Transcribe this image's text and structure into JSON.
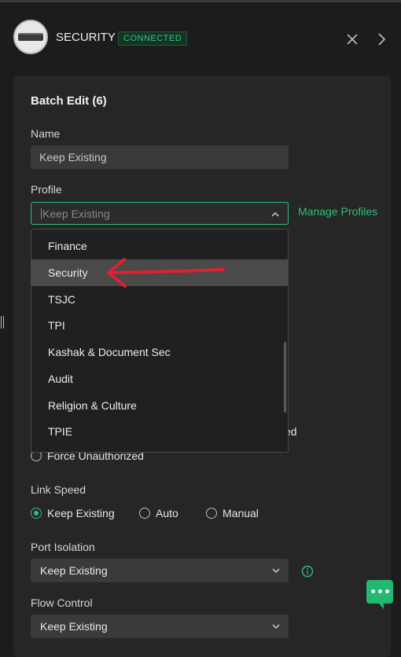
{
  "device": {
    "name": "SECURITY",
    "status": "CONNECTED"
  },
  "header": {
    "icons": [
      "close-icon",
      "chevron-right-icon"
    ]
  },
  "form": {
    "title": "Batch Edit (6)",
    "name": {
      "label": "Name",
      "placeholder": "Keep Existing"
    },
    "profile": {
      "label": "Profile",
      "placeholder": "Keep Existing",
      "manage_link": "Manage Profiles",
      "options": [
        "Finance",
        "Security",
        "TSJC",
        "TPI",
        "Kashak & Document Sec",
        "Audit",
        "Religion & Culture",
        "TPIE"
      ],
      "highlighted": "Security"
    },
    "partial_behind": "ed",
    "force_unauthorized": "Force Unauthorized",
    "link_speed": {
      "label": "Link Speed",
      "options": [
        "Keep Existing",
        "Auto",
        "Manual"
      ],
      "selected": "Keep Existing"
    },
    "port_isolation": {
      "label": "Port Isolation",
      "value": "Keep Existing"
    },
    "flow_control": {
      "label": "Flow Control",
      "value": "Keep Existing"
    }
  },
  "colors": {
    "accent": "#2fbf7a",
    "annotation_arrow": "#e0202e",
    "background": "#1c1c1c",
    "panel": "#262626"
  }
}
